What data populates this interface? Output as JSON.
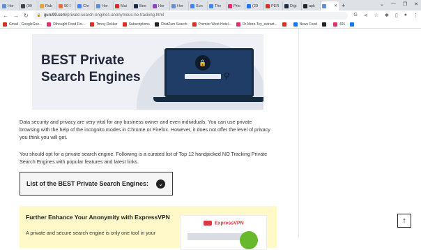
{
  "browser": {
    "tabs": [
      {
        "label": "Hor",
        "color": "#5f8fd6"
      },
      {
        "label": "(99",
        "color": "#444444"
      },
      {
        "label": "Rub",
        "color": "#e8a33d"
      },
      {
        "label": "50 I",
        "color": "#e8703d"
      },
      {
        "label": "Chr",
        "color": "#4285f4"
      },
      {
        "label": "Hor",
        "color": "#5f8fd6"
      },
      {
        "label": "Mai",
        "color": "#d93025"
      },
      {
        "label": "Bee",
        "color": "#1d2b44"
      },
      {
        "label": "Hor",
        "color": "#8a3fd1"
      },
      {
        "label": "Hor",
        "color": "#5f8fd6"
      },
      {
        "label": "Sun",
        "color": "#4285f4"
      },
      {
        "label": "The",
        "color": "#4285f4"
      },
      {
        "label": "Prio",
        "color": "#e1306c"
      },
      {
        "label": "(20",
        "color": "#1877f2"
      },
      {
        "label": "PER",
        "color": "#d93025"
      },
      {
        "label": "Digi",
        "color": "#1f2a44"
      },
      {
        "label": "apk",
        "color": "#222222"
      },
      {
        "label": "",
        "color": "#5f8fd6",
        "active": true
      }
    ],
    "new_tab_label": "+",
    "url_host": "guru99.com",
    "url_path": "/private-search-engines-anonymous-no-tracking.html",
    "bookmarks": [
      {
        "label": "Gmail - GoogleGoo...",
        "color": "#d93025"
      },
      {
        "label": "Rthought Food For...",
        "color": "#e1306c"
      },
      {
        "label": "Tonny Dekker",
        "color": "#d93025"
      },
      {
        "label": "Subscriptions",
        "color": "#d93025"
      },
      {
        "label": "ChatZum Search",
        "color": "#222222"
      },
      {
        "label": "Premier West Hotel...",
        "color": "#d93025"
      },
      {
        "label": "Dr-Mero-Tey_extract...",
        "color": "#e1306c"
      },
      {
        "label": "",
        "color": "#d93025"
      },
      {
        "label": "News Feed",
        "color": "#1877f2"
      },
      {
        "label": "",
        "color": "#222222"
      },
      {
        "label": "491",
        "color": "#e1306c"
      },
      {
        "label": "",
        "color": "#1877f2"
      }
    ]
  },
  "article": {
    "hero_title_line1": "BEST Private",
    "hero_title_line2": "Search Engines",
    "paragraph1": "Data security and privacy are very vital for any business owner and even individuals. You can use private browsing with the help of the incognito modes in Chrome or Firefox. However, it does not offer the level of privacy you think you will get.",
    "paragraph2": "You should opt for a private search engine. Following is a curated list of Top 12 handpicked NO Tracking Private Search Engines with popular features and latest links.",
    "toc_label": "List of the BEST Private Search Engines:",
    "promo_title": "Further Enhance Your Anonymity with ExpressVPN",
    "promo_text": "A private and secure search engine is only one tool in your",
    "vpn_brand": "ExpressVPN"
  }
}
